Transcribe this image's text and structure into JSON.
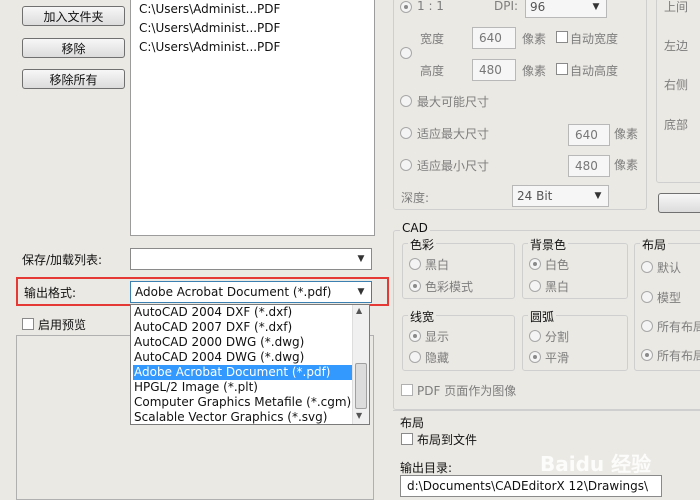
{
  "left": {
    "buttons": {
      "add_folder": "加入文件夹",
      "remove": "移除",
      "remove_all": "移除所有"
    },
    "files": [
      {
        "path": "C:\\Users\\Administ...",
        "type": "PDF"
      },
      {
        "path": "C:\\Users\\Administ...",
        "type": "PDF"
      },
      {
        "path": "C:\\Users\\Administ...",
        "type": "PDF"
      }
    ],
    "save_load_label": "保存/加载列表:",
    "output_format_label": "输出格式:",
    "output_format_value": "Adobe Acrobat Document (*.pdf)",
    "enable_preview_label": "启用预览",
    "format_options": [
      "AutoCAD 2004 DXF (*.dxf)",
      "AutoCAD 2007 DXF (*.dxf)",
      "AutoCAD 2000 DWG (*.dwg)",
      "AutoCAD 2004 DWG (*.dwg)",
      "Adobe Acrobat Document (*.pdf)",
      "HPGL/2 Image (*.plt)",
      "Computer Graphics Metafile (*.cgm)",
      "Scalable Vector Graphics (*.svg)"
    ],
    "selected_option_index": 4,
    "highlight_color": "#e53935"
  },
  "image": {
    "ratio": "1 : 1",
    "dpi_label": "DPI:",
    "dpi_value": "96",
    "width_label": "宽度",
    "width_value": "640",
    "height_label": "高度",
    "height_value": "480",
    "pixel_unit": "像素",
    "auto_width": "自动宽度",
    "auto_height": "自动高度",
    "max_size": "最大可能尺寸",
    "fit_max": "适应最大尺寸",
    "fit_max_value": "640",
    "fit_min": "适应最小尺寸",
    "fit_min_value": "480",
    "depth_label": "深度:",
    "depth_value": "24 Bit"
  },
  "margins": {
    "top": "上间",
    "left": "左边",
    "right": "右侧",
    "bottom": "底部"
  },
  "cad": {
    "title": "CAD",
    "color": {
      "title": "色彩",
      "options": [
        "黑白",
        "色彩模式"
      ],
      "selected": 1
    },
    "background": {
      "title": "背景色",
      "options": [
        "白色",
        "黑白"
      ],
      "selected": 0
    },
    "layout": {
      "title": "布局",
      "options": [
        "默认",
        "模型",
        "所有布局",
        "所有布局"
      ],
      "selected": 3
    },
    "linewidth": {
      "title": "线宽",
      "options": [
        "显示",
        "隐藏"
      ],
      "selected": 0
    },
    "arc": {
      "title": "圆弧",
      "options": [
        "分割",
        "平滑"
      ],
      "selected": 1
    },
    "pdf_as_image": "PDF 页面作为图像"
  },
  "layout_section": {
    "title": "布局",
    "layout_to_file": "布局到文件"
  },
  "output_dir": {
    "label": "输出目录:",
    "value": "d:\\Documents\\CADEditorX 12\\Drawings\\"
  },
  "watermark": "Baidu 经验"
}
